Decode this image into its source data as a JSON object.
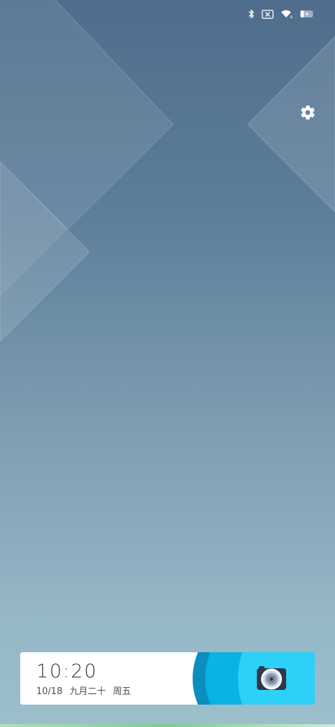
{
  "status_bar": {
    "icons": [
      "bluetooth-icon",
      "no-sim-icon",
      "wifi-icon",
      "battery-charging-icon"
    ]
  },
  "lockscreen": {
    "settings_icon": "gear-icon",
    "time": "10:20",
    "date": "10/18",
    "lunar_date": "九月二十",
    "weekday": "周五",
    "camera_icon": "camera-icon"
  },
  "colors": {
    "background_top": "#4f6d8c",
    "background_bottom": "#9cbfcc",
    "card": "#ffffff",
    "camera_accent_dark": "#0a8fbd",
    "camera_accent": "#08b3e6",
    "camera_accent_light": "#2dd0f7",
    "bottom_line": "#7bcf86"
  }
}
